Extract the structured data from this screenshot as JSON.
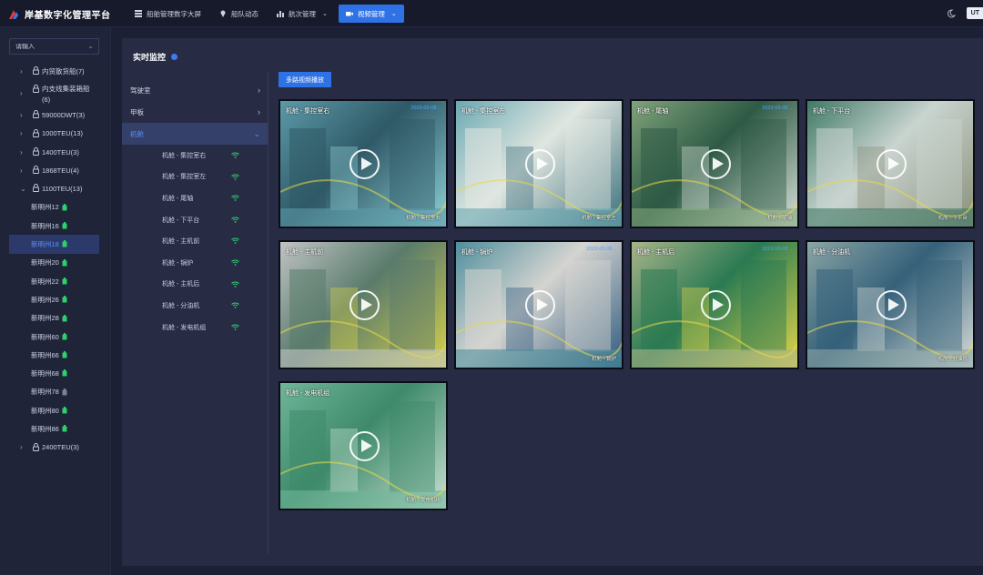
{
  "app": {
    "title": "岸基数字化管理平台"
  },
  "nav": {
    "items": [
      {
        "label": "船舶管理数字大屏",
        "icon": "dashboard-icon",
        "active": false,
        "dropdown": false
      },
      {
        "label": "船队动态",
        "icon": "location-pin-icon",
        "active": false,
        "dropdown": false
      },
      {
        "label": "航次管理",
        "icon": "bar-chart-icon",
        "active": false,
        "dropdown": true
      },
      {
        "label": "视频管理",
        "icon": "video-camera-icon",
        "active": true,
        "dropdown": true
      }
    ]
  },
  "topright": {
    "theme_icon": "moon-icon",
    "utc_label": "UT"
  },
  "sidebar": {
    "search_placeholder": "请输入",
    "groups": [
      {
        "label": "内贸散货船(7)",
        "expanded": false
      },
      {
        "label": "内支线集装箱船",
        "label2": "(6)",
        "expanded": false
      },
      {
        "label": "59000DWT(3)",
        "expanded": false
      },
      {
        "label": "1000TEU(13)",
        "expanded": false
      },
      {
        "label": "1400TEU(3)",
        "expanded": false
      },
      {
        "label": "1868TEU(4)",
        "expanded": false
      },
      {
        "label": "1100TEU(13)",
        "expanded": true
      }
    ],
    "ships": [
      {
        "label": "新明州12",
        "online": true,
        "active": false
      },
      {
        "label": "新明州16",
        "online": true,
        "active": false
      },
      {
        "label": "新明州18",
        "online": true,
        "active": true
      },
      {
        "label": "新明州20",
        "online": true,
        "active": false
      },
      {
        "label": "新明州22",
        "online": true,
        "active": false
      },
      {
        "label": "新明州26",
        "online": true,
        "active": false
      },
      {
        "label": "新明州28",
        "online": true,
        "active": false
      },
      {
        "label": "新明州60",
        "online": true,
        "active": false
      },
      {
        "label": "新明州66",
        "online": true,
        "active": false
      },
      {
        "label": "新明州68",
        "online": true,
        "active": false
      },
      {
        "label": "新明州78",
        "online": false,
        "active": false
      },
      {
        "label": "新明州80",
        "online": true,
        "active": false
      },
      {
        "label": "新明州86",
        "online": true,
        "active": false
      }
    ],
    "last_group": {
      "label": "2400TEU(3)",
      "expanded": false
    }
  },
  "main": {
    "title": "实时监控",
    "sections": [
      {
        "label": "驾驶室",
        "active": false
      },
      {
        "label": "甲板",
        "active": false
      },
      {
        "label": "机舱",
        "active": true
      }
    ],
    "cameras": [
      "机舱 - 集控室右",
      "机舱 - 集控室左",
      "机舱 - 尾轴",
      "机舱 - 下平台",
      "机舱 - 主机前",
      "机舱 - 锅炉",
      "机舱 - 主机后",
      "机舱 - 分油机",
      "机舱 - 发电机组"
    ],
    "multi_play_label": "多路视频播放",
    "tiles": [
      {
        "label": "机舱 - 集控室右",
        "foot": "机舱 - 集控室右",
        "stamp": "2023-03-08 ..",
        "palette": [
          "#5c9aa8",
          "#2f5966",
          "#8ed0d6"
        ]
      },
      {
        "label": "机舱 - 集控室左",
        "foot": "机舱 - 集控室左",
        "stamp": "",
        "palette": [
          "#6aa9b3",
          "#e0e6e0",
          "#3b6f7c"
        ]
      },
      {
        "label": "机舱 - 尾轴",
        "foot": "机舱 - 尾轴",
        "stamp": "2023-03-08 ..",
        "palette": [
          "#7fa37a",
          "#2e5a45",
          "#d8e0d8"
        ]
      },
      {
        "label": "机舱 - 下平台",
        "foot": "机舱 - 下平台",
        "stamp": "",
        "palette": [
          "#3f7a66",
          "#c9d4cf",
          "#8a8f7a"
        ]
      },
      {
        "label": "机舱 - 主机前",
        "foot": "",
        "stamp": "",
        "palette": [
          "#c0c4c4",
          "#5a7b6c",
          "#d6d04a"
        ]
      },
      {
        "label": "机舱 - 锅炉",
        "foot": "机舱 - 锅炉",
        "stamp": "2023-03-08 ..",
        "palette": [
          "#4f8f9d",
          "#d4d4d0",
          "#2f5a7e"
        ]
      },
      {
        "label": "机舱 - 主机后",
        "foot": "",
        "stamp": "2023-03-08 ..",
        "palette": [
          "#a8b48a",
          "#2b7a52",
          "#e2d64a"
        ]
      },
      {
        "label": "机舱 - 分油机",
        "foot": "机舱 - 分油机",
        "stamp": "",
        "palette": [
          "#8aa5a5",
          "#35617a",
          "#d8dcd8"
        ]
      },
      {
        "label": "机舱 - 发电机组",
        "foot": "机舱 - 发电机组",
        "stamp": "",
        "palette": [
          "#6fb59a",
          "#3e8a6a",
          "#c9e0d4"
        ]
      }
    ]
  }
}
